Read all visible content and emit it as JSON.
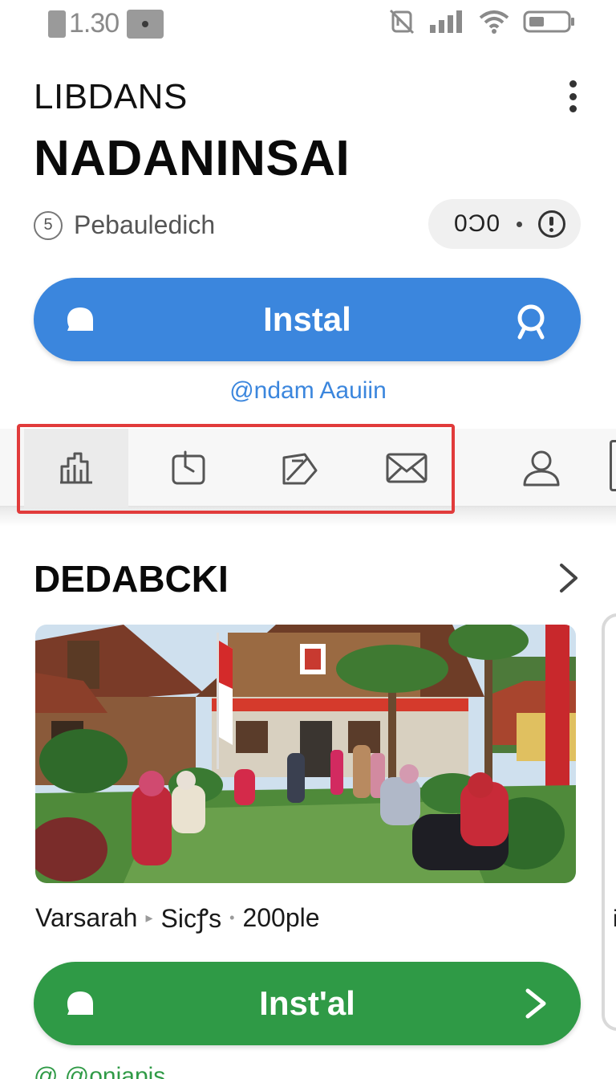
{
  "status_bar": {
    "time": "1.30"
  },
  "header": {
    "subtitle": "LIBDANS",
    "title": "NADANINSAI",
    "meta_number": "5",
    "meta_label": "Pebauledich",
    "pill_text": "0Ͻ0"
  },
  "install_primary": {
    "label": "Instal",
    "developer_link": "@ndam Aauiin"
  },
  "tabs": [
    {
      "icon": "chart-icon"
    },
    {
      "icon": "clock-icon"
    },
    {
      "icon": "tag-icon"
    },
    {
      "icon": "mail-icon"
    },
    {
      "icon": "user-icon"
    }
  ],
  "section": {
    "title": "DEDABCKI",
    "caption": {
      "part1": "Varsarah",
      "part2": "Sicꝭs",
      "part3": "200ple"
    }
  },
  "install_secondary": {
    "label": "Inst'al"
  },
  "side_card": {
    "label": "i"
  },
  "footer": {
    "link": "@ @oniapis"
  },
  "colors": {
    "primary_blue": "#3b86dd",
    "install_green": "#2f9a46",
    "highlight_red": "#e13b3b"
  }
}
